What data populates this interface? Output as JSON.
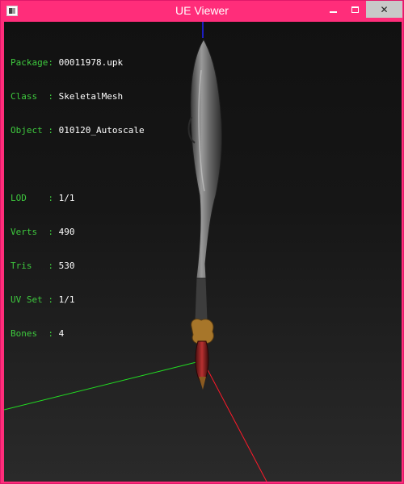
{
  "window": {
    "title": "UE Viewer"
  },
  "info": {
    "package": {
      "label": "Package:",
      "value": "00011978.upk"
    },
    "class": {
      "label": "Class  :",
      "value": "SkeletalMesh"
    },
    "object": {
      "label": "Object :",
      "value": "010120_Autoscale"
    },
    "lod": {
      "label": "LOD    :",
      "value": "1/1"
    },
    "verts": {
      "label": "Verts  :",
      "value": "490"
    },
    "tris": {
      "label": "Tris   :",
      "value": "530"
    },
    "uvset": {
      "label": "UV Set :",
      "value": "1/1"
    },
    "bones": {
      "label": "Bones  :",
      "value": "4"
    }
  },
  "colors": {
    "title_bar": "#ff2d7a",
    "label_text": "#3ec93e",
    "value_text": "#ffffff",
    "axis_x": "#ff1a2a",
    "axis_y": "#22dd22",
    "axis_z": "#2222ff"
  }
}
